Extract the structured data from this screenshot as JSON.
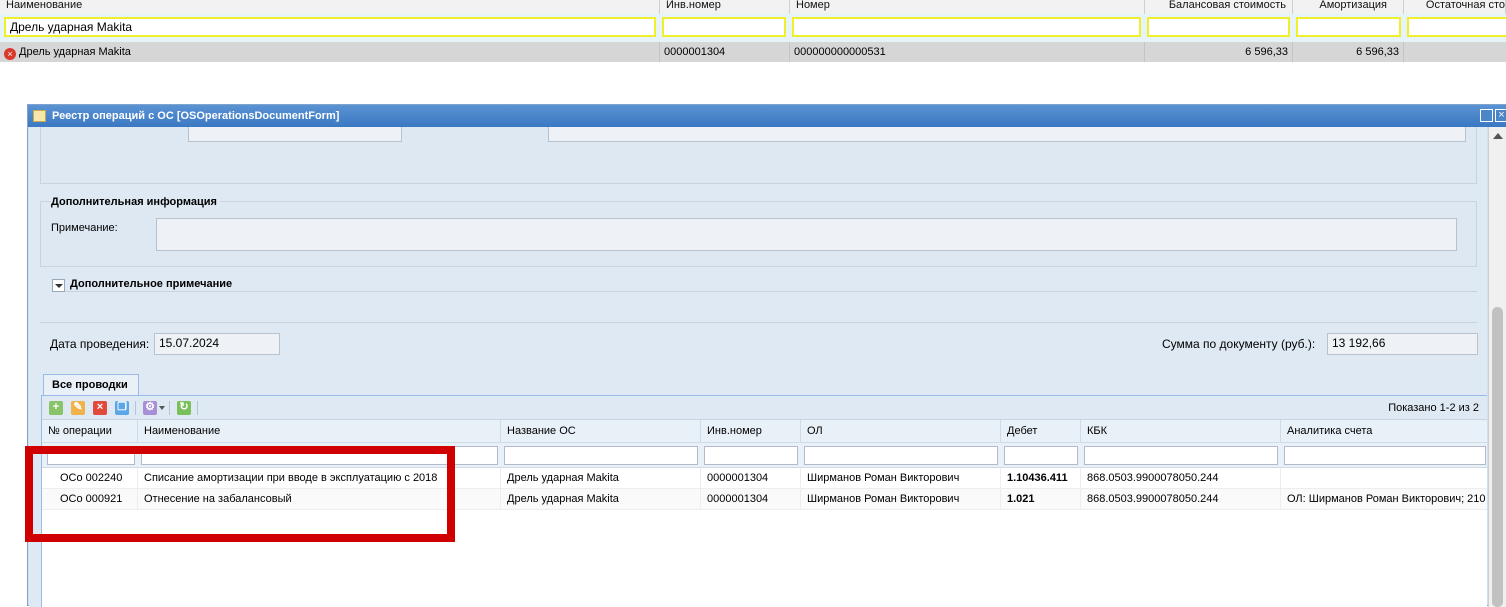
{
  "top_grid": {
    "columns": [
      "Наименование",
      "Инв.номер",
      "Номер",
      "Балансовая стоимость",
      "Амортизация",
      "Остаточная сто"
    ],
    "filter_value": "Дрель ударная Makita",
    "row": {
      "name": "Дрель ударная Makita",
      "inv": "0000001304",
      "number": "000000000000531",
      "balance": "6 596,33",
      "amort": "6 596,33"
    }
  },
  "window": {
    "title": "Реестр операций с ОС [OSOperationsDocumentForm]",
    "section_additional": "Дополнительная информация",
    "note_label": "Примечание:",
    "additional_note": "Дополнительное примечание",
    "date_label": "Дата проведения:",
    "date_value": "15.07.2024",
    "sum_label": "Сумма по документу (руб.):",
    "sum_value": "13 192,66"
  },
  "grid": {
    "tab_label": "Все проводки",
    "shown_text": "Показано 1-2 из 2",
    "columns": [
      "№ операции",
      "Наименование",
      "Название ОС",
      "Инв.номер",
      "ОЛ",
      "Дебет",
      "КБК",
      "Аналитика счета"
    ],
    "rows": [
      {
        "op": "ОСо 002240",
        "name": "Списание амортизации при вводе в эксплуатацию с 2018",
        "os": "Дрель ударная Makita",
        "inv": "0000001304",
        "ol": "Ширманов Роман Викторович",
        "debit": "1.10436.411",
        "kbk": "868.0503.9900078050.244",
        "analytics": ""
      },
      {
        "op": "ОСо 000921",
        "name": "Отнесение на забалансовый",
        "os": "Дрель ударная Makita",
        "inv": "0000001304",
        "ol": "Ширманов Роман Викторович",
        "debit": "1.021",
        "kbk": "868.0503.9900078050.244",
        "analytics": "ОЛ: Ширманов Роман Викторович; 210"
      }
    ]
  },
  "colors": {
    "title_bar": "#3a78c2",
    "filter_highlight": "#f1ee2d",
    "annotation": "#d10000",
    "selected_row": "#d6d6d6"
  },
  "icons": [
    "error-icon",
    "form-icon",
    "maximize-icon",
    "close-icon",
    "add-icon",
    "edit-icon",
    "delete-icon",
    "copy-icon",
    "settings-icon",
    "refresh-icon",
    "expand-icon"
  ]
}
